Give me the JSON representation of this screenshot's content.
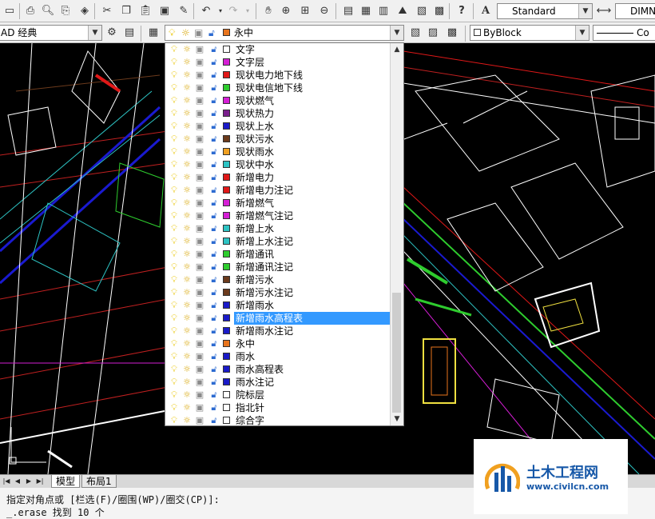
{
  "toolbar": {
    "text_style": "Standard",
    "dim_style": "DIMN",
    "workspace": "AD 经典",
    "current_layer": "永中",
    "current_layer_color": "#e8741c",
    "color_control": "ByBlock",
    "linetype_partial": "Co"
  },
  "layers": [
    {
      "name": "文字",
      "color": "#ffffff"
    },
    {
      "name": "文字层",
      "color": "#d51ed5"
    },
    {
      "name": "现状电力地下线",
      "color": "#e01818"
    },
    {
      "name": "现状电信地下线",
      "color": "#2ecc2e"
    },
    {
      "name": "现状燃气",
      "color": "#d51ed5"
    },
    {
      "name": "现状热力",
      "color": "#7a1e8c"
    },
    {
      "name": "现状上水",
      "color": "#1a1ac8"
    },
    {
      "name": "现状污水",
      "color": "#6b3a1c"
    },
    {
      "name": "现状雨水",
      "color": "#f0a020"
    },
    {
      "name": "现状中水",
      "color": "#2dc3c3"
    },
    {
      "name": "新增电力",
      "color": "#e01818"
    },
    {
      "name": "新增电力注记",
      "color": "#e01818"
    },
    {
      "name": "新增燃气",
      "color": "#d51ed5"
    },
    {
      "name": "新增燃气注记",
      "color": "#d51ed5"
    },
    {
      "name": "新增上水",
      "color": "#2dc3c3"
    },
    {
      "name": "新增上水注记",
      "color": "#2dc3c3"
    },
    {
      "name": "新增通讯",
      "color": "#2ecc2e"
    },
    {
      "name": "新增通讯注记",
      "color": "#2ecc2e"
    },
    {
      "name": "新增污水",
      "color": "#6b3a1c"
    },
    {
      "name": "新增污水注记",
      "color": "#6b3a1c"
    },
    {
      "name": "新增雨水",
      "color": "#1a1ac8"
    },
    {
      "name": "新增雨水高程表",
      "color": "#1a1ac8",
      "selected": true
    },
    {
      "name": "新增雨水注记",
      "color": "#1a1ac8"
    },
    {
      "name": "永中",
      "color": "#e8741c"
    },
    {
      "name": "雨水",
      "color": "#1a1ac8"
    },
    {
      "name": "雨水高程表",
      "color": "#1a1ac8"
    },
    {
      "name": "雨水注记",
      "color": "#1a1ac8"
    },
    {
      "name": "院标层",
      "color": "#ffffff"
    },
    {
      "name": "指北针",
      "color": "#ffffff"
    },
    {
      "name": "综合字",
      "color": "#ffffff"
    }
  ],
  "tabs": {
    "model": "模型",
    "layout1": "布局1"
  },
  "command": {
    "line1": "指定对角点或 [栏选(F)/圈围(WP)/圈交(CP)]:",
    "line2": "_.erase 找到 10 个"
  },
  "watermark": {
    "title": "土木工程网",
    "url": "www.civilcn.com"
  }
}
